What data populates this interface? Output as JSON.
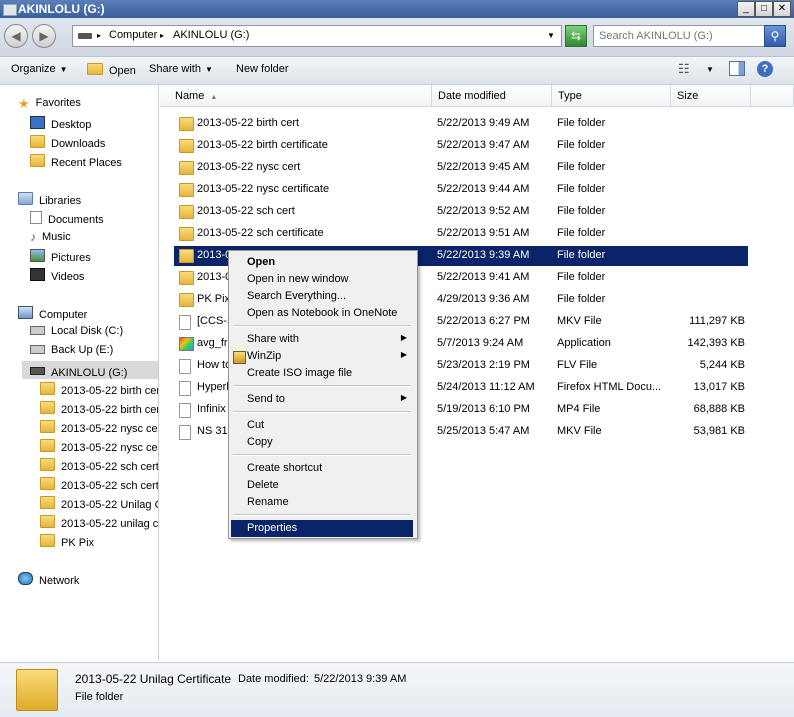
{
  "window": {
    "title": "AKINLOLU (G:)",
    "caption_buttons": [
      "_",
      "□",
      "✕"
    ]
  },
  "address": {
    "crumbs": [
      "Computer",
      "AKINLOLU (G:)"
    ],
    "separator": "▸",
    "search_placeholder": "Search AKINLOLU (G:)"
  },
  "toolbar": {
    "organize": "Organize",
    "open": "Open",
    "share_with": "Share with",
    "new_folder": "New folder"
  },
  "nav": {
    "favorites": {
      "header": "Favorites",
      "items": [
        "Desktop",
        "Downloads",
        "Recent Places"
      ]
    },
    "libraries": {
      "header": "Libraries",
      "items": [
        "Documents",
        "Music",
        "Pictures",
        "Videos"
      ]
    },
    "computer": {
      "header": "Computer",
      "drives": [
        "Local Disk (C:)",
        "Back Up (E:)",
        "AKINLOLU (G:)"
      ],
      "subfolders": [
        "2013-05-22 birth cer",
        "2013-05-22 birth cer",
        "2013-05-22 nysc cer",
        "2013-05-22 nysc cer",
        "2013-05-22 sch cert",
        "2013-05-22 sch cert",
        "2013-05-22 Unilag C",
        "2013-05-22 unilag ce",
        "PK Pix"
      ]
    },
    "network": "Network"
  },
  "columns": {
    "name": "Name",
    "date": "Date modified",
    "type": "Type",
    "size": "Size"
  },
  "files": [
    {
      "name": "2013-05-22 birth cert",
      "date": "5/22/2013 9:49 AM",
      "type": "File folder",
      "size": "",
      "icon": "folder-icon"
    },
    {
      "name": "2013-05-22 birth certificate",
      "date": "5/22/2013 9:47 AM",
      "type": "File folder",
      "size": "",
      "icon": "folder-icon"
    },
    {
      "name": "2013-05-22 nysc cert",
      "date": "5/22/2013 9:45 AM",
      "type": "File folder",
      "size": "",
      "icon": "folder-icon"
    },
    {
      "name": "2013-05-22 nysc certificate",
      "date": "5/22/2013 9:44 AM",
      "type": "File folder",
      "size": "",
      "icon": "folder-icon"
    },
    {
      "name": "2013-05-22 sch cert",
      "date": "5/22/2013 9:52 AM",
      "type": "File folder",
      "size": "",
      "icon": "folder-icon"
    },
    {
      "name": "2013-05-22 sch certificate",
      "date": "5/22/2013 9:51 AM",
      "type": "File folder",
      "size": "",
      "icon": "folder-icon"
    },
    {
      "name": "2013-0",
      "date": "5/22/2013 9:39 AM",
      "type": "File folder",
      "size": "",
      "icon": "folder-icon",
      "selected": true
    },
    {
      "name": "2013-0",
      "date": "5/22/2013 9:41 AM",
      "type": "File folder",
      "size": "",
      "icon": "folder-icon"
    },
    {
      "name": "PK Pix",
      "date": "4/29/2013 9:36 AM",
      "type": "File folder",
      "size": "",
      "icon": "folder-icon"
    },
    {
      "name": "[CCS-S",
      "date": "5/22/2013 6:27 PM",
      "type": "MKV File",
      "size": "111,297 KB",
      "icon": "file-icon"
    },
    {
      "name": "avg_fr",
      "date": "5/7/2013 9:24 AM",
      "type": "Application",
      "size": "142,393 KB",
      "icon": "app-icon"
    },
    {
      "name": "How to",
      "date": "5/23/2013 2:19 PM",
      "type": "FLV File",
      "size": "5,244 KB",
      "icon": "file-icon"
    },
    {
      "name": "Hyperl",
      "date": "5/24/2013 11:12 AM",
      "type": "Firefox HTML Docu...",
      "size": "13,017 KB",
      "icon": "file-icon"
    },
    {
      "name": "Infinix",
      "date": "5/19/2013 6:10 PM",
      "type": "MP4 File",
      "size": "68,888 KB",
      "icon": "file-icon"
    },
    {
      "name": "NS  31",
      "date": "5/25/2013 5:47 AM",
      "type": "MKV File",
      "size": "53,981 KB",
      "icon": "file-icon"
    }
  ],
  "context_menu": {
    "items": [
      {
        "label": "Open",
        "bold": true
      },
      {
        "label": "Open in new window"
      },
      {
        "label": "Search Everything..."
      },
      {
        "label": "Open as Notebook in OneNote"
      },
      {
        "separator": true
      },
      {
        "label": "Share with",
        "submenu": true
      },
      {
        "label": "WinZip",
        "submenu": true,
        "icon": "winzip-icon"
      },
      {
        "label": "Create ISO image file"
      },
      {
        "separator": true
      },
      {
        "label": "Send to",
        "submenu": true
      },
      {
        "separator": true
      },
      {
        "label": "Cut"
      },
      {
        "label": "Copy"
      },
      {
        "separator": true
      },
      {
        "label": "Create shortcut"
      },
      {
        "label": "Delete"
      },
      {
        "label": "Rename"
      },
      {
        "separator": true
      },
      {
        "label": "Properties",
        "highlighted": true
      }
    ]
  },
  "details": {
    "name": "2013-05-22 Unilag Certificate",
    "date_label": "Date modified:",
    "date_value": "5/22/2013 9:39 AM",
    "type": "File folder"
  }
}
